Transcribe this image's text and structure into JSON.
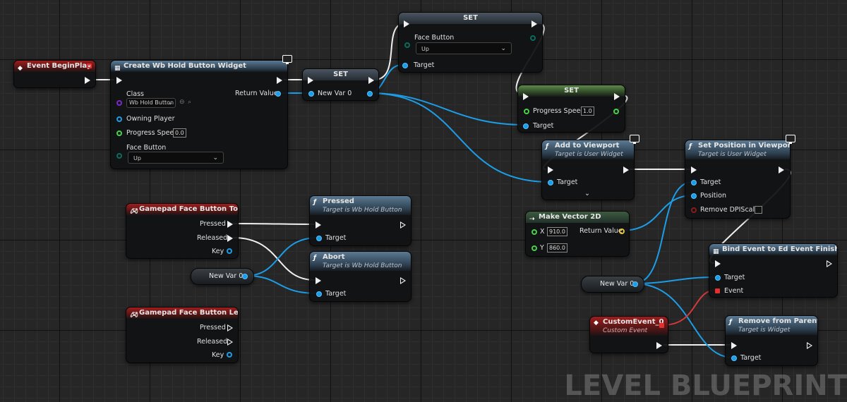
{
  "watermark": "LEVEL BLUEPRINT",
  "colors": {
    "exec_wire": "#f0f0f0",
    "object_wire": "#1c9de6",
    "event_wire": "#d23a3a",
    "float": "#49d147",
    "class": "#7d2ac4",
    "enum": "#0c6b5c",
    "vector": "#e6c23a"
  },
  "nodes": {
    "begin_play": {
      "title": "Event BeginPlay"
    },
    "create_widget": {
      "title": "Create Wb Hold Button Widget",
      "class_label": "Class",
      "class_value": "Wb Hold Button",
      "owning_player": "Owning Player",
      "progress_speed": "Progress Speed",
      "progress_value": "0.0",
      "face_button": "Face Button",
      "face_value": "Up",
      "return_value": "Return Value"
    },
    "set1": {
      "title": "SET",
      "var_label": "New Var 0"
    },
    "set2": {
      "title": "SET",
      "face_button": "Face Button",
      "face_value": "Up",
      "target": "Target"
    },
    "set3": {
      "title": "SET",
      "progress_speed": "Progress Speed",
      "progress_value": "1.0",
      "target": "Target"
    },
    "add_viewport": {
      "title": "Add to Viewport",
      "subtitle": "Target is User Widget",
      "target": "Target"
    },
    "set_position": {
      "title": "Set Position in Viewport",
      "subtitle": "Target is User Widget",
      "target": "Target",
      "position": "Position",
      "remove_dpi": "Remove DPIScale"
    },
    "make_vector": {
      "title": "Make Vector 2D",
      "x_label": "X",
      "x_value": "910.0",
      "y_label": "Y",
      "y_value": "860.0",
      "return_value": "Return Value"
    },
    "gamepad_top": {
      "title": "Gamepad Face Button Top",
      "pressed": "Pressed",
      "released": "Released",
      "key": "Key"
    },
    "gamepad_left": {
      "title": "Gamepad Face Button Left",
      "pressed": "Pressed",
      "released": "Released",
      "key": "Key"
    },
    "pressed": {
      "title": "Pressed",
      "subtitle": "Target is Wb Hold Button",
      "target": "Target"
    },
    "abort": {
      "title": "Abort",
      "subtitle": "Target is Wb Hold Button",
      "target": "Target"
    },
    "var_get_left": {
      "label": "New Var 0"
    },
    "var_get_right": {
      "label": "New Var 0"
    },
    "bind_event": {
      "title": "Bind Event to Ed Event Finished",
      "target": "Target",
      "event": "Event"
    },
    "custom_event": {
      "title": "CustomEvent_0",
      "subtitle": "Custom Event"
    },
    "remove_parent": {
      "title": "Remove from Parent",
      "subtitle": "Target is Widget",
      "target": "Target"
    }
  }
}
